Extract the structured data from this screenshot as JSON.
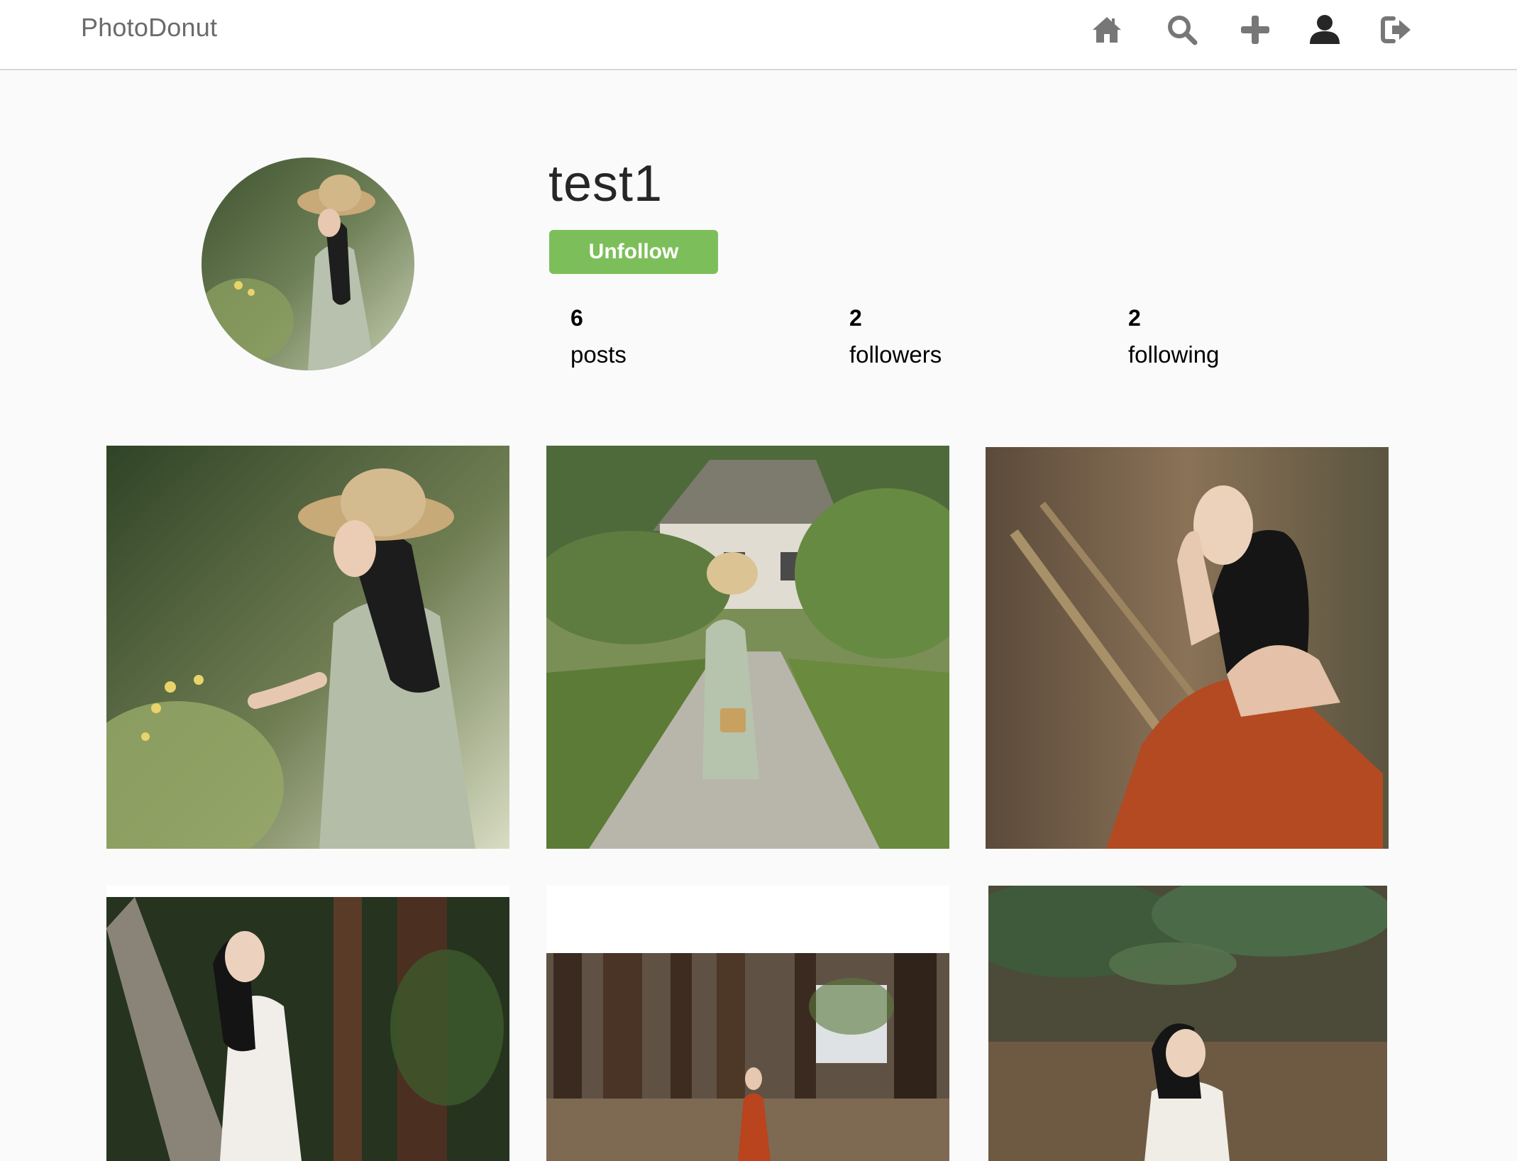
{
  "navbar": {
    "brand": "PhotoDonut",
    "icons": [
      "home-icon",
      "search-icon",
      "plus-icon",
      "user-icon",
      "sign-out-icon"
    ]
  },
  "profile": {
    "username": "test1",
    "follow_button_label": "Unfollow",
    "stats": {
      "posts": {
        "count": "6",
        "label": "posts"
      },
      "followers": {
        "count": "2",
        "label": "followers"
      },
      "following": {
        "count": "2",
        "label": "following"
      }
    }
  },
  "colors": {
    "accent_green": "#7cbf5a",
    "icon_gray": "#777777",
    "active_icon": "#262626"
  },
  "posts_shown": 6
}
